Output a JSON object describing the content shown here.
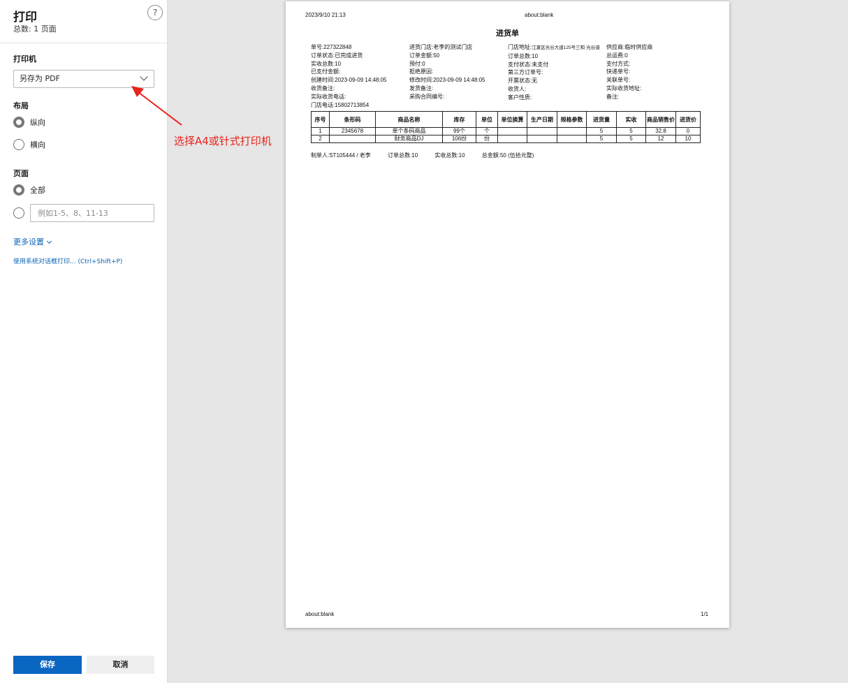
{
  "panel": {
    "title": "打印",
    "page_count": "总数: 1 页面",
    "help": "?",
    "printer_label": "打印机",
    "printer_value": "另存为 PDF",
    "layout_label": "布局",
    "layout_portrait": "纵向",
    "layout_landscape": "横向",
    "pages_label": "页面",
    "pages_all": "全部",
    "pages_placeholder": "例如1-5、8、11-13",
    "more_settings": "更多设置",
    "system_dialog": "使用系统对话框打印... (Ctrl+Shift+P)",
    "save": "保存",
    "cancel": "取消"
  },
  "annotation": {
    "text": "选择A4或针式打印机",
    "color": "#e8231b"
  },
  "preview": {
    "header_date": "2023/9/10 21:13",
    "header_url": "about:blank",
    "title": "进货单",
    "info_col1": [
      "单号:227322848",
      "订单状态:已完成进货",
      "实收总数:10",
      "已支付金额:",
      "创建时间:2023-09-09 14:48:05",
      "收货备注:",
      "实际收货电话:",
      "门店电话:15802713854"
    ],
    "info_col2": [
      "进货门店:老李的测试门店",
      "订单金额:50",
      "预付:0",
      "拒绝原因:",
      "修改时间:2023-09-09 14:48:05",
      "发货备注:",
      "采购合同编号:"
    ],
    "info_col3_first_label": "门店地址:",
    "info_col3_first_small": "江夏区光谷大道125号三和·光谷道",
    "info_col3": [
      "订单总数:10",
      "支付状态:未支付",
      "第三方订单号:",
      "开票状态:无",
      "收货人:",
      "客户性质:"
    ],
    "info_col4": [
      "供应商:临时供应商",
      "总运费:0",
      "支付方式:",
      "快递单号:",
      "关联单号:",
      "实际收货地址:",
      "备注:"
    ],
    "table": {
      "headers": [
        "序号",
        "条形码",
        "商品名称",
        "库存",
        "单位",
        "单位换算",
        "生产日期",
        "规格参数",
        "进货量",
        "实收",
        "商品销售价",
        "进货价"
      ],
      "rows": [
        [
          "1",
          "2345678",
          "单个条码商品",
          "99个",
          "个",
          "",
          "",
          "",
          "5",
          "5",
          "32.8",
          "0"
        ],
        [
          "2",
          "",
          "财务商品DJ",
          "106份",
          "份",
          "",
          "",
          "",
          "5",
          "5",
          "12",
          "10"
        ]
      ]
    },
    "summary": [
      "制单人:ST105444 / 老李",
      "订单总数:10",
      "实收总数:10",
      "总金额:50 (伍拾元整)"
    ],
    "footer_url": "about:blank",
    "footer_page": "1/1"
  }
}
